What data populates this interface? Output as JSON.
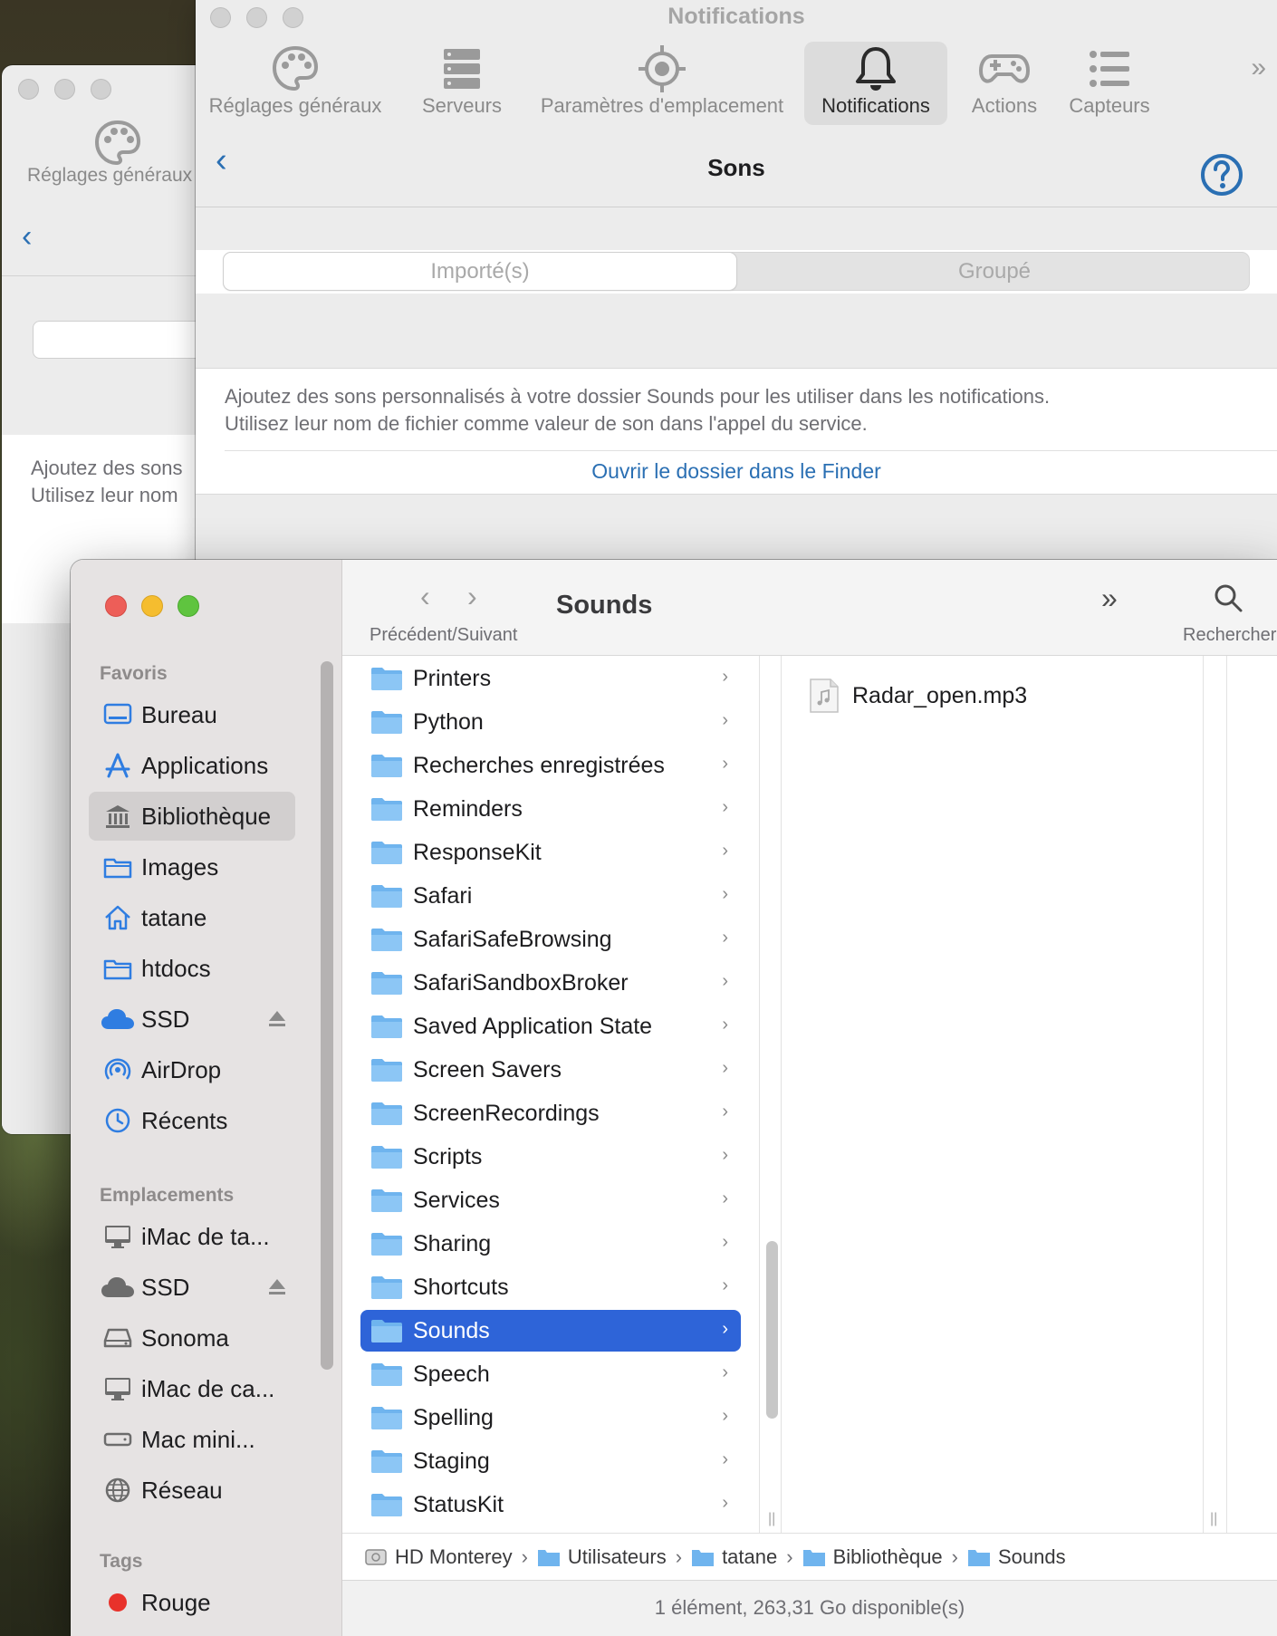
{
  "back_window": {
    "tool_label": "Réglages généraux",
    "info_text_line1": "Ajoutez des sons",
    "info_text_line2": "Utilisez leur nom"
  },
  "notifications_window": {
    "title": "Notifications",
    "toolbar": [
      {
        "label": "Réglages généraux",
        "icon": "palette-icon"
      },
      {
        "label": "Serveurs",
        "icon": "server-icon"
      },
      {
        "label": "Paramètres d'emplacement",
        "icon": "location-target-icon"
      },
      {
        "label": "Notifications",
        "icon": "bell-icon",
        "active": true
      },
      {
        "label": "Actions",
        "icon": "gamepad-icon"
      },
      {
        "label": "Capteurs",
        "icon": "list-icon"
      }
    ],
    "page_title": "Sons",
    "segments": [
      "Importé(s)",
      "Groupé"
    ],
    "selected_segment": "Importé(s)",
    "info_line1": "Ajoutez des sons personnalisés à votre dossier Sounds pour les utiliser dans les notifications.",
    "info_line2": "Utilisez leur nom de fichier comme valeur de son dans l'appel du service.",
    "open_link": "Ouvrir le dossier dans le Finder"
  },
  "finder": {
    "title": "Sounds",
    "nav_label": "Précédent/Suivant",
    "search_label": "Rechercher",
    "sidebar": {
      "favorites_header": "Favoris",
      "favorites": [
        {
          "label": "Bureau",
          "icon": "desktop-icon"
        },
        {
          "label": "Applications",
          "icon": "applications-icon"
        },
        {
          "label": "Bibliothèque",
          "icon": "library-icon",
          "active": true
        },
        {
          "label": "Images",
          "icon": "folder-icon"
        },
        {
          "label": "tatane",
          "icon": "home-icon"
        },
        {
          "label": "htdocs",
          "icon": "folder-icon"
        },
        {
          "label": "SSD",
          "icon": "cloud-icon",
          "eject": true
        },
        {
          "label": "AirDrop",
          "icon": "airdrop-icon"
        },
        {
          "label": "Récents",
          "icon": "clock-icon"
        }
      ],
      "locations_header": "Emplacements",
      "locations": [
        {
          "label": "iMac de ta...",
          "icon": "imac-icon"
        },
        {
          "label": "SSD",
          "icon": "cloud-icon",
          "eject": true
        },
        {
          "label": "Sonoma",
          "icon": "drive-icon"
        },
        {
          "label": "iMac de ca...",
          "icon": "imac-icon"
        },
        {
          "label": "Mac mini...",
          "icon": "macmini-icon"
        },
        {
          "label": "Réseau",
          "icon": "globe-icon"
        }
      ],
      "tags_header": "Tags",
      "tags": [
        {
          "label": "Rouge",
          "color": "#e8322b"
        }
      ]
    },
    "folders": [
      "Printers",
      "Python",
      "Recherches enregistrées",
      "Reminders",
      "ResponseKit",
      "Safari",
      "SafariSafeBrowsing",
      "SafariSandboxBroker",
      "Saved Application State",
      "Screen Savers",
      "ScreenRecordings",
      "Scripts",
      "Services",
      "Sharing",
      "Shortcuts",
      "Sounds",
      "Speech",
      "Spelling",
      "Staging",
      "StatusKit"
    ],
    "selected_folder": "Sounds",
    "files": [
      "Radar_open.mp3"
    ],
    "path": [
      "HD Monterey",
      "Utilisateurs",
      "tatane",
      "Bibliothèque",
      "Sounds"
    ],
    "status": "1 élément, 263,31 Go disponible(s)"
  },
  "colors": {
    "accent_link": "#2a6fb3",
    "selection": "#2e64d8",
    "folder": "#6fb4ee"
  }
}
